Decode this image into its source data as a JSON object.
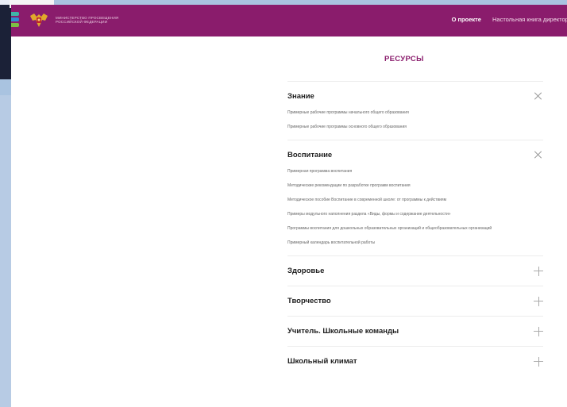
{
  "header": {
    "ministry_line1": "МИНИСТЕРСТВО ПРОСВЕЩЕНИЯ",
    "ministry_line2": "РОССИЙСКОЙ ФЕДЕРАЦИИ",
    "nav": [
      {
        "label": "О проекте"
      },
      {
        "label": "Настольная книга директора"
      }
    ],
    "logo_colors": [
      "#3fb6a8",
      "#2f8fd0",
      "#7bc043"
    ],
    "accent": "#8a1c6c"
  },
  "resources_title": "РЕСУРСЫ",
  "sections": [
    {
      "title": "Знание",
      "expanded": true,
      "links": [
        "Примерные рабочие программы начального общего образования",
        "Примерные рабочие программы основного общего образования"
      ]
    },
    {
      "title": "Воспитание",
      "expanded": true,
      "links": [
        "Примерная программа воспитания",
        "Методические рекомендации по разработке программ воспитания",
        "Методическое пособие Воспитание в современной школе: от программы к действиям",
        "Примеры модульного наполнения раздела «Виды, формы и содержание деятельности»",
        "Программы воспитания для дошкольных образовательных организаций и общеобразовательных организаций",
        "Примерный календарь воспитательной работы"
      ]
    },
    {
      "title": "Здоровье",
      "expanded": false
    },
    {
      "title": "Творчество",
      "expanded": false
    },
    {
      "title": "Учитель. Школьные команды",
      "expanded": false
    },
    {
      "title": "Школьный климат",
      "expanded": false
    }
  ]
}
